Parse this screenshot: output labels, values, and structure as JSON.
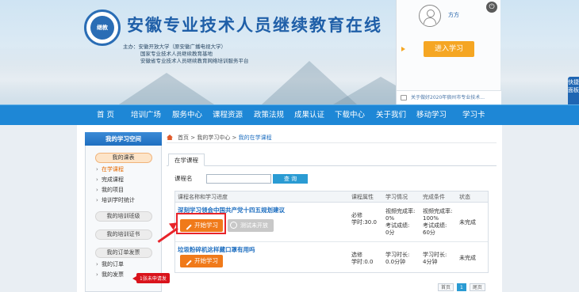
{
  "header": {
    "site_title": "安徽专业技术人员继续教育在线",
    "logo_text": "安徽专业技术人员继续教育",
    "host_lines": [
      "主办：安徽开放大学（原安徽广播电视大学）",
      "国家专业技术人员继续教育基地",
      "安徽省专业技术人员继续教育网络培训服务平台"
    ]
  },
  "user_panel": {
    "username": "方方",
    "enter_button": "进入学习",
    "notice": "关于做好2020年宿州市专业技术..."
  },
  "side_tab": "快捷面板",
  "nav": {
    "items": [
      "首 页",
      "培训广场",
      "服务中心",
      "课程资源",
      "政策法规",
      "成果认证",
      "下载中心",
      "关于我们",
      "移动学习",
      "学习卡"
    ]
  },
  "sidebar": {
    "title": "我的学习空间",
    "groups": [
      {
        "label": "我的课表",
        "subs": [
          "在学课程",
          "完成课程",
          "我的项目",
          "培训学时统计"
        ]
      },
      {
        "label": "我的培训班级",
        "subs": []
      },
      {
        "label": "我的培训证书",
        "subs": []
      },
      {
        "label": "我的订单发票",
        "subs": [
          "我的订单",
          "我的发票"
        ]
      }
    ],
    "badge": "1张未申请发"
  },
  "breadcrumb": {
    "home": "首页",
    "sep1": " > ",
    "center": "我的学习中心",
    "sep2": " > ",
    "current": "我的在学课程"
  },
  "tabs": [
    "在学课程"
  ],
  "search": {
    "label": "课程名",
    "value": "",
    "button": "查 询"
  },
  "table": {
    "headers": [
      "课程名称和学习进度",
      "课程属性",
      "学习情况",
      "完成条件",
      "状态"
    ],
    "rows": [
      {
        "title": "深刻学习领会中国共产党十四五规划建议",
        "start": "开始学习",
        "exam": "测试未开放",
        "attr": [
          "必修",
          "学时:30.0"
        ],
        "study": [
          "视频完成率:",
          "0%",
          "考试成绩:",
          "0分"
        ],
        "cond": [
          "视频完成率:",
          "100%",
          "考试成绩:",
          "60分"
        ],
        "status": "未完成"
      },
      {
        "title": "垃圾粉碎机这样藏口罩有用吗",
        "start": "开始学习",
        "attr": [
          "选修",
          "学时:0.0"
        ],
        "study": [
          "学习时长:",
          "0.0分钟"
        ],
        "cond": [
          "学习时长:",
          "4分钟"
        ],
        "status": "未完成"
      }
    ]
  },
  "pager": {
    "first": "首页",
    "current": "1",
    "last": "尾页"
  },
  "colors": {
    "brand_blue": "#1f6fc0",
    "nav_blue": "#1e87d6",
    "orange": "#f07a1a",
    "alert_red": "#e8242a"
  }
}
